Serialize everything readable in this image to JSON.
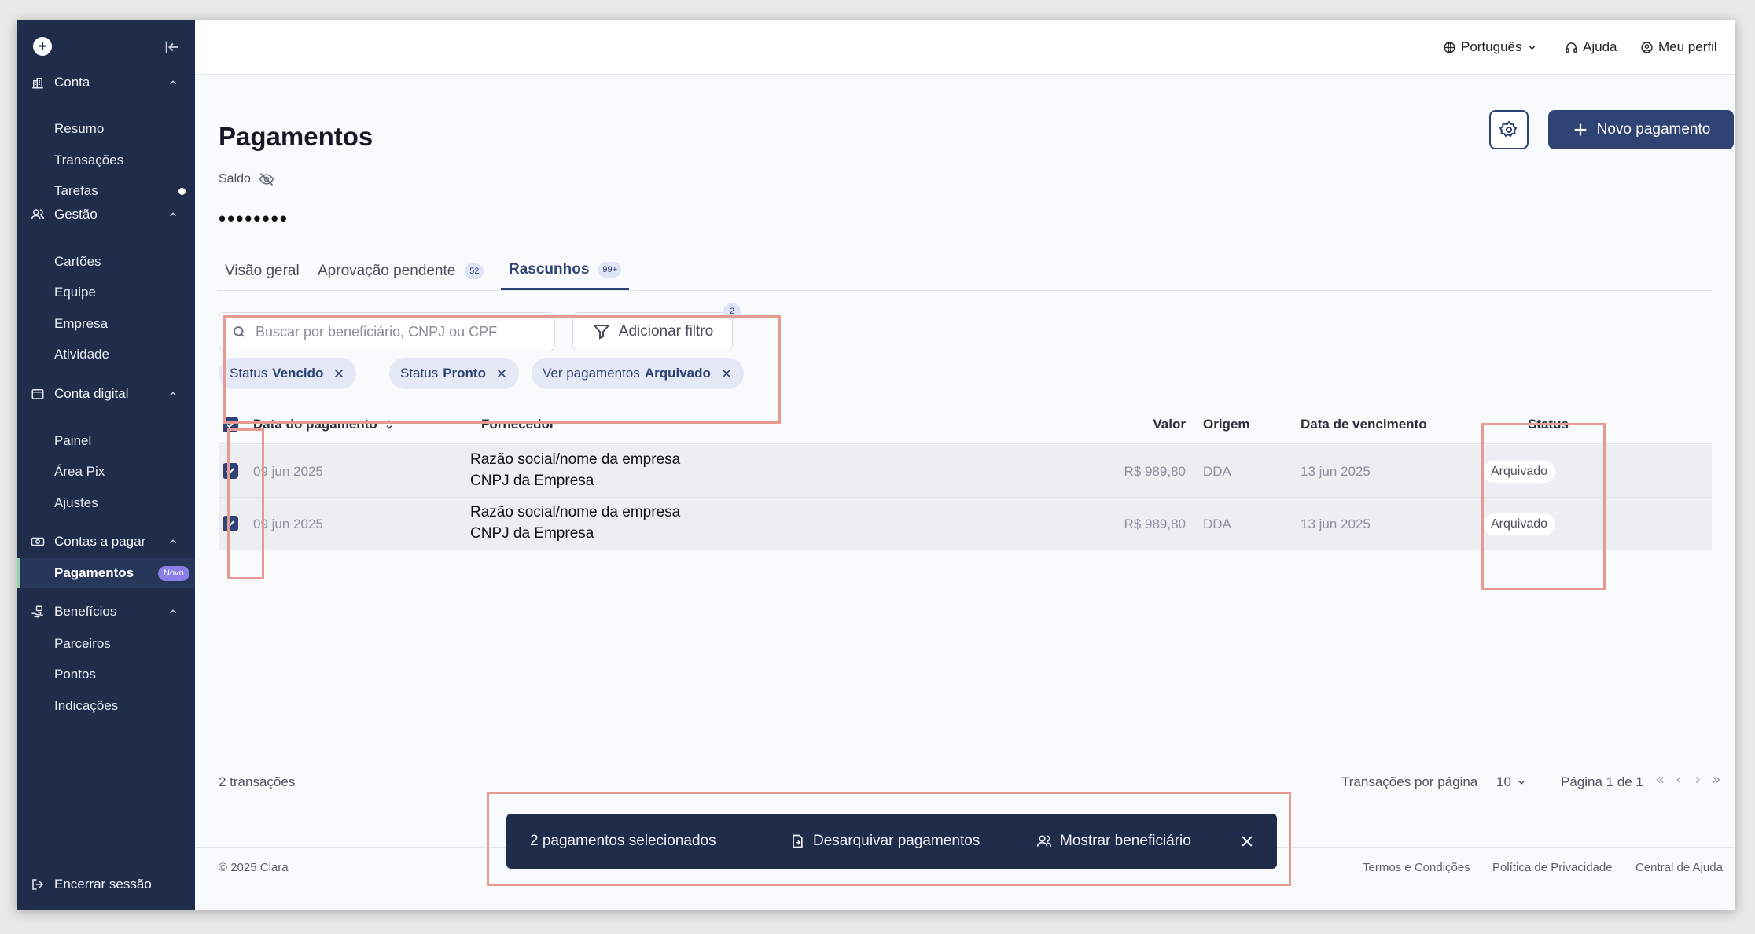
{
  "sidebar": {
    "sections": [
      {
        "label": "Conta",
        "icon": "bank-icon",
        "items": [
          "Resumo",
          "Transações",
          "Tarefas"
        ]
      },
      {
        "label": "Gestão",
        "icon": "users-icon",
        "items": [
          "Cartões",
          "Equipe",
          "Empresa",
          "Atividade"
        ]
      },
      {
        "label": "Conta digital",
        "icon": "wallet-icon",
        "items": [
          "Painel",
          "Área Pix",
          "Ajustes"
        ]
      },
      {
        "label": "Contas a pagar",
        "icon": "cash-icon",
        "items": [
          "Pagamentos"
        ]
      },
      {
        "label": "Benefícios",
        "icon": "gift-hand-icon",
        "items": [
          "Parceiros",
          "Pontos",
          "Indicações"
        ]
      }
    ],
    "new_badge": "Novo",
    "logout": "Encerrar sessão"
  },
  "topbar": {
    "language": "Português",
    "help": "Ajuda",
    "profile": "Meu perfil"
  },
  "page": {
    "title": "Pagamentos",
    "new_payment": "Novo pagamento",
    "balance_label": "Saldo",
    "balance_value": "••••••••"
  },
  "tabs": [
    {
      "label": "Visão geral",
      "badge": ""
    },
    {
      "label": "Aprovação pendente",
      "badge": "52"
    },
    {
      "label": "Rascunhos",
      "badge": "99+"
    }
  ],
  "filters": {
    "search_placeholder": "Buscar por beneficiário, CNPJ ou CPF",
    "add_filter": "Adicionar filtro",
    "filter_count": "2",
    "chips": [
      {
        "prefix": "Status",
        "value": "Vencido"
      },
      {
        "prefix": "Status",
        "value": "Pronto"
      },
      {
        "prefix": "Ver pagamentos",
        "value": "Arquivado"
      }
    ]
  },
  "table": {
    "columns": [
      "Data do pagamento",
      "Fornecedor",
      "Valor",
      "Origem",
      "Data de vencimento",
      "Status"
    ],
    "rows": [
      {
        "date": "09 jun 2025",
        "supplier_name": "Razão social/nome da empresa",
        "supplier_id": "CNPJ da Empresa",
        "value": "R$ 989,80",
        "origin": "DDA",
        "due": "13 jun 2025",
        "status": "Arquivado"
      },
      {
        "date": "09 jun 2025",
        "supplier_name": "Razão social/nome da empresa",
        "supplier_id": "CNPJ da Empresa",
        "value": "R$ 989,80",
        "origin": "DDA",
        "due": "13 jun 2025",
        "status": "Arquivado"
      }
    ],
    "count_text": "2 transações",
    "per_page_label": "Transações por página",
    "per_page_value": "10",
    "page_text": "Página 1 de 1"
  },
  "action_bar": {
    "selected": "2 pagamentos selecionados",
    "unarchive": "Desarquivar pagamentos",
    "show_beneficiary": "Mostrar beneficiário"
  },
  "footer": {
    "copyright": "© 2025 Clara",
    "links": [
      "Termos e Condições",
      "Política de Privacidade",
      "Central de Ajuda"
    ]
  }
}
